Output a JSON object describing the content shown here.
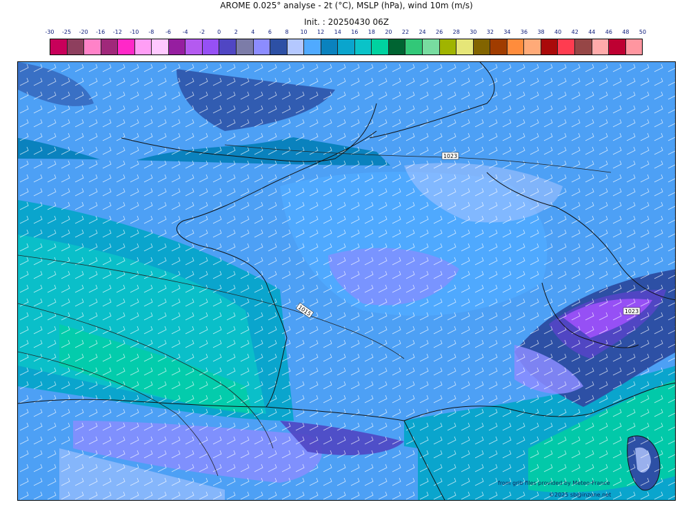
{
  "header": {
    "title": "AROME 0.025° analyse - 2t (°C), MSLP (hPa), wind 10m (m/s)",
    "init": "Init. : 20250430 06Z"
  },
  "legend": {
    "ticks": [
      "-30",
      "-25",
      "-20",
      "-16",
      "-12",
      "-10",
      "-8",
      "-6",
      "-4",
      "-2",
      "0",
      "2",
      "4",
      "6",
      "8",
      "10",
      "12",
      "14",
      "16",
      "18",
      "20",
      "22",
      "24",
      "26",
      "28",
      "30",
      "32",
      "34",
      "36",
      "38",
      "40",
      "42",
      "44",
      "46",
      "48",
      "50"
    ],
    "colors": [
      "#c8005a",
      "#8e3f5e",
      "#ff82c8",
      "#a0287a",
      "#ff28c8",
      "#ff9ef5",
      "#ffc8ff",
      "#961ea0",
      "#b45af0",
      "#9650f5",
      "#5046c3",
      "#7c7ca8",
      "#8c8cff",
      "#2d50a5",
      "#b4c8ff",
      "#50aaff",
      "#0a82be",
      "#0aa5cd",
      "#0ac3c8",
      "#00d2a0",
      "#006432",
      "#32c878",
      "#78dca0",
      "#a0b400",
      "#e6e678",
      "#826400",
      "#a03c00",
      "#ff8c3c",
      "#ffaa78",
      "#aa0a0a",
      "#ff3c50",
      "#964646",
      "#ffaaaa",
      "#be0032",
      "#ff96a0"
    ]
  },
  "isobars": [
    {
      "label": "1023"
    },
    {
      "label": "1015"
    },
    {
      "label": "1023"
    }
  ],
  "credits": {
    "source": "from grib files provided by Meteo-France",
    "copyright": "©2025 sb@inzone.net"
  }
}
